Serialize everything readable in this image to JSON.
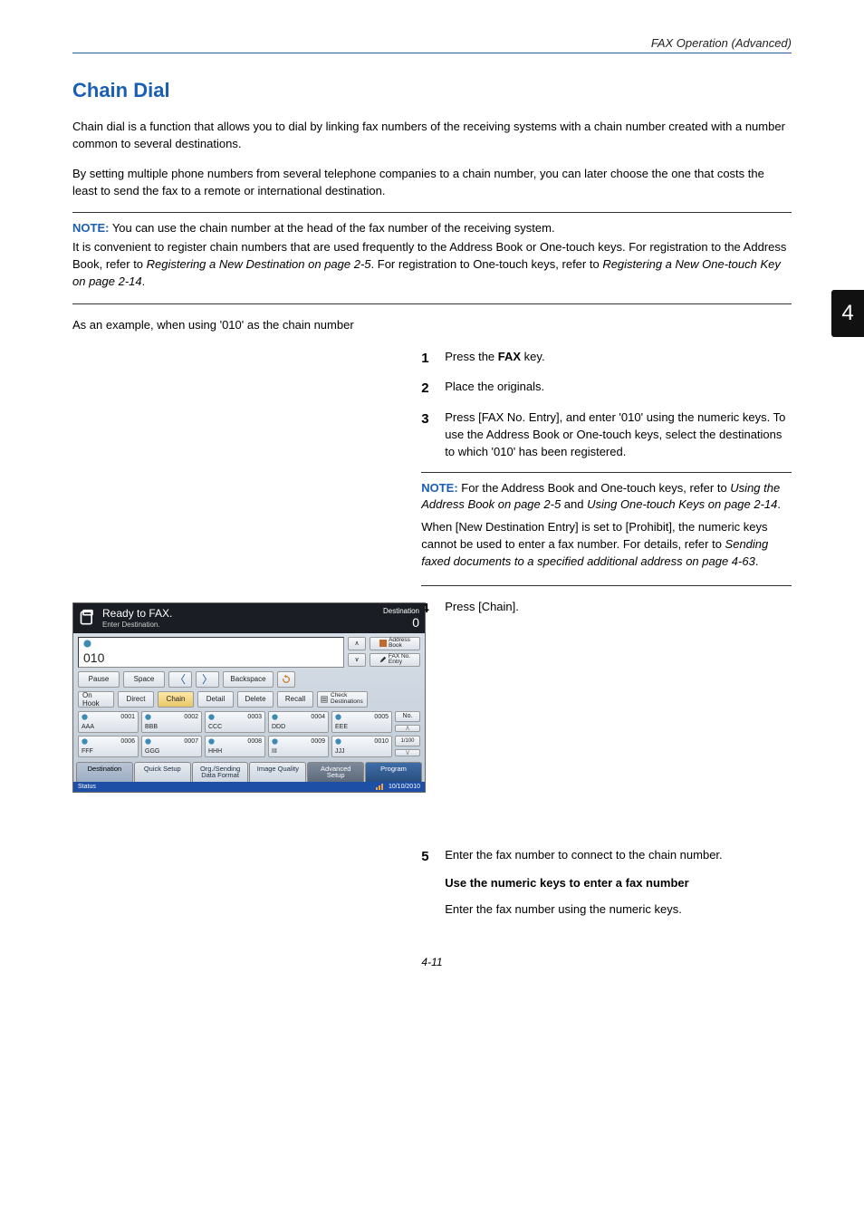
{
  "header": {
    "running_head": "FAX Operation (Advanced)"
  },
  "page_tab": "4",
  "title": "Chain Dial",
  "intro": [
    "Chain dial is a function that allows you to dial by linking fax numbers of the receiving systems with a chain number created with a number common to several destinations.",
    "By setting multiple phone numbers from several telephone companies to a chain number, you can later choose the one that costs the least to send the fax to a remote or international destination."
  ],
  "note1": {
    "label": "NOTE:",
    "part1": " You can use the chain number at the head of the fax number of the receiving system.",
    "part2a": "It is convenient to register chain numbers that are used frequently to the Address Book or One-touch keys. For registration to the Address Book, refer to ",
    "part2_ref1": "Registering a New Destination on page 2-5",
    "part2b": ". For registration to One-touch keys, refer to ",
    "part2_ref2": "Registering a New One-touch Key on page 2-14",
    "part2c": "."
  },
  "example_line": "As an example, when using '010' as the chain number",
  "steps": {
    "s1": {
      "n": "1",
      "text_a": "Press the ",
      "bold": "FAX",
      "text_b": " key."
    },
    "s2": {
      "n": "2",
      "text": "Place the originals."
    },
    "s3": {
      "n": "3",
      "text": "Press [FAX No. Entry], and enter '010' using the numeric keys. To use the Address Book or One-touch keys, select the destinations to which '010' has been registered."
    },
    "s4": {
      "n": "4",
      "text": "Press [Chain]."
    },
    "s5": {
      "n": "5",
      "text": "Enter the fax number to connect to the chain number."
    }
  },
  "note2": {
    "label": "NOTE:",
    "p1a": " For the Address Book and One-touch keys, refer to ",
    "p1_ref1": "Using the Address Book on page 2-5",
    "p1b": " and ",
    "p1_ref2": "Using One-touch Keys on page 2-14",
    "p1c": ".",
    "p2a": "When [New Destination Entry] is set to [Prohibit], the numeric keys cannot be used to enter a fax number. For details, refer to ",
    "p2_ref": "Sending faxed documents to a specified additional address on page 4-63",
    "p2b": "."
  },
  "step5_sub": {
    "heading": "Use the numeric keys to enter a fax number",
    "text": "Enter the fax number using the numeric keys."
  },
  "footer": {
    "pagenum": "4-11"
  },
  "fax_panel": {
    "title": "Ready to FAX.",
    "subtitle": "Enter Destination.",
    "dest_label": "Destination",
    "dest_count": "0",
    "number_value": "010",
    "side": {
      "address_book": "Address\nBook",
      "faxno_entry": "FAX No.\nEntry",
      "check_dest": "Check\nDestinations"
    },
    "row1": {
      "pause": "Pause",
      "space": "Space",
      "backspace": "Backspace"
    },
    "row2": {
      "onhook": "On Hook",
      "direct": "Direct",
      "chain": "Chain",
      "detail": "Detail",
      "delete": "Delete",
      "recall": "Recall"
    },
    "onetouch": [
      {
        "num": "0001",
        "label": "AAA"
      },
      {
        "num": "0002",
        "label": "BBB"
      },
      {
        "num": "0003",
        "label": "CCC"
      },
      {
        "num": "0004",
        "label": "DDD"
      },
      {
        "num": "0005",
        "label": "EEE"
      },
      {
        "num": "0006",
        "label": "FFF"
      },
      {
        "num": "0007",
        "label": "GGG"
      },
      {
        "num": "0008",
        "label": "HHH"
      },
      {
        "num": "0009",
        "label": "III"
      },
      {
        "num": "0010",
        "label": "JJJ"
      }
    ],
    "no_btn": "No.",
    "page_ind": "1/100",
    "tabs": {
      "destination": "Destination",
      "quick": "Quick Setup",
      "org": "Org./Sending\nData Format",
      "image": "Image Quality",
      "advanced": "Advanced\nSetup",
      "program": "Program"
    },
    "status": {
      "label": "Status",
      "date": "10/10/2010"
    }
  }
}
